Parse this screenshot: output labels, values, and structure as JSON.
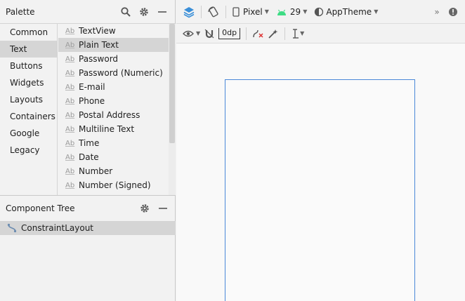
{
  "palette": {
    "title": "Palette",
    "categories": [
      "Common",
      "Text",
      "Buttons",
      "Widgets",
      "Layouts",
      "Containers",
      "Google",
      "Legacy"
    ],
    "selected_category": "Text",
    "widget_prefix": "Ab",
    "widgets": [
      "TextView",
      "Plain Text",
      "Password",
      "Password (Numeric)",
      "E-mail",
      "Phone",
      "Postal Address",
      "Multiline Text",
      "Time",
      "Date",
      "Number",
      "Number (Signed)"
    ],
    "selected_widget": "Plain Text"
  },
  "component_tree": {
    "title": "Component Tree",
    "root": "ConstraintLayout"
  },
  "toolbar": {
    "device": "Pixel",
    "api_level": "29",
    "theme": "AppTheme",
    "overflow": "»",
    "default_margin": "0dp"
  },
  "colors": {
    "accent": "#4a88d8",
    "android_green": "#3ddc84",
    "selection": "#d5d5d5"
  }
}
